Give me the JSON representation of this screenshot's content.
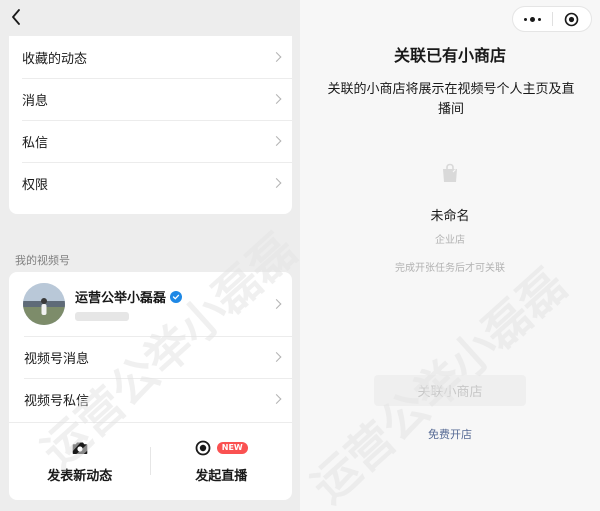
{
  "left": {
    "menu_items": [
      {
        "label": "收藏的动态"
      },
      {
        "label": "消息"
      },
      {
        "label": "私信"
      },
      {
        "label": "权限"
      }
    ],
    "section_label": "我的视频号",
    "profile": {
      "name": "运营公举小磊磊"
    },
    "channel_items": [
      {
        "label": "视频号消息"
      },
      {
        "label": "视频号私信"
      }
    ],
    "actions": {
      "post_label": "发表新动态",
      "live_label": "发起直播",
      "new_badge": "NEW"
    }
  },
  "right": {
    "title": "关联已有小商店",
    "description": "关联的小商店将展示在视频号个人主页及直播间",
    "shop_name": "未命名",
    "shop_type": "企业店",
    "shop_hint": "完成开张任务后才可关联",
    "link_button": "关联小商店",
    "open_link": "免费开店"
  },
  "watermark": {
    "text": "运营公举小磊磊"
  },
  "colors": {
    "link": "#576b95",
    "badge": "#fa5151",
    "verified": "#1e88e5"
  }
}
